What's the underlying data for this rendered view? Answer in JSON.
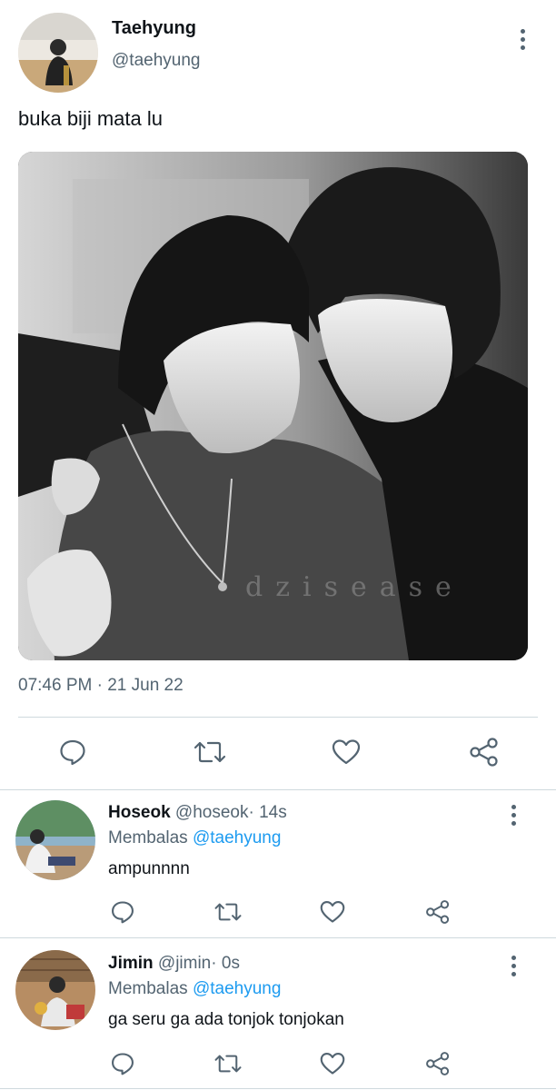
{
  "main_tweet": {
    "author_name": "Taehyung",
    "author_handle": "@taehyung",
    "text": "buka biji mata lu",
    "image_watermark": "dzisease",
    "timestamp": "07:46 PM · 21 Jun 22"
  },
  "action_icons": [
    "reply-icon",
    "retweet-icon",
    "like-icon",
    "share-icon"
  ],
  "replies": [
    {
      "author_name": "Hoseok",
      "author_handle": "@hoseok",
      "time": "· 14s",
      "reply_prefix": "Membalas",
      "reply_to": "@taehyung",
      "text": "ampunnnn"
    },
    {
      "author_name": "Jimin",
      "author_handle": "@jimin",
      "time": "· 0s",
      "reply_prefix": "Membalas",
      "reply_to": "@taehyung",
      "text": "ga seru ga ada tonjok tonjokan"
    }
  ],
  "colors": {
    "accent": "#1d9bf0",
    "secondary_text": "#536471",
    "divider": "#cfd9de"
  }
}
